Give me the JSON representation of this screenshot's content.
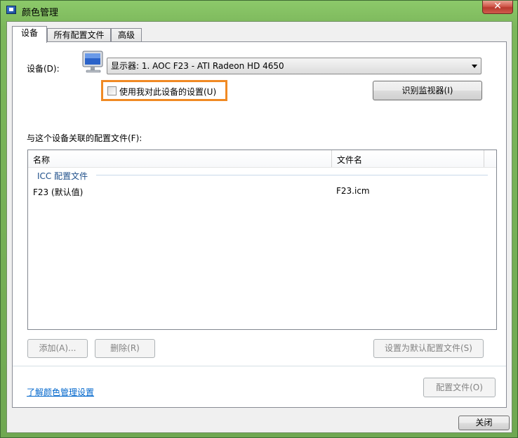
{
  "window": {
    "title": "颜色管理",
    "close_label": "✕"
  },
  "tabs": [
    {
      "label": "设备"
    },
    {
      "label": "所有配置文件"
    },
    {
      "label": "高级"
    }
  ],
  "device": {
    "label": "设备(D):",
    "selected": "显示器: 1. AOC F23 - ATI Radeon HD 4650",
    "use_settings_label": "使用我对此设备的设置(U)",
    "identify_label": "识别监视器(I)"
  },
  "profiles": {
    "label": "与这个设备关联的配置文件(F):",
    "columns": [
      "名称",
      "文件名"
    ],
    "group": "ICC 配置文件",
    "rows": [
      {
        "name": "F23 (默认值)",
        "file": "F23.icm"
      }
    ]
  },
  "actions": {
    "add_label": "添加(A)...",
    "remove_label": "删除(R)",
    "set_default_label": "设置为默认配置文件(S)"
  },
  "footer": {
    "link_label": "了解颜色管理设置",
    "profiles_label": "配置文件(O)",
    "close_label": "关闭"
  },
  "colors": {
    "highlight": "#f08a24",
    "link": "#0066cc"
  }
}
